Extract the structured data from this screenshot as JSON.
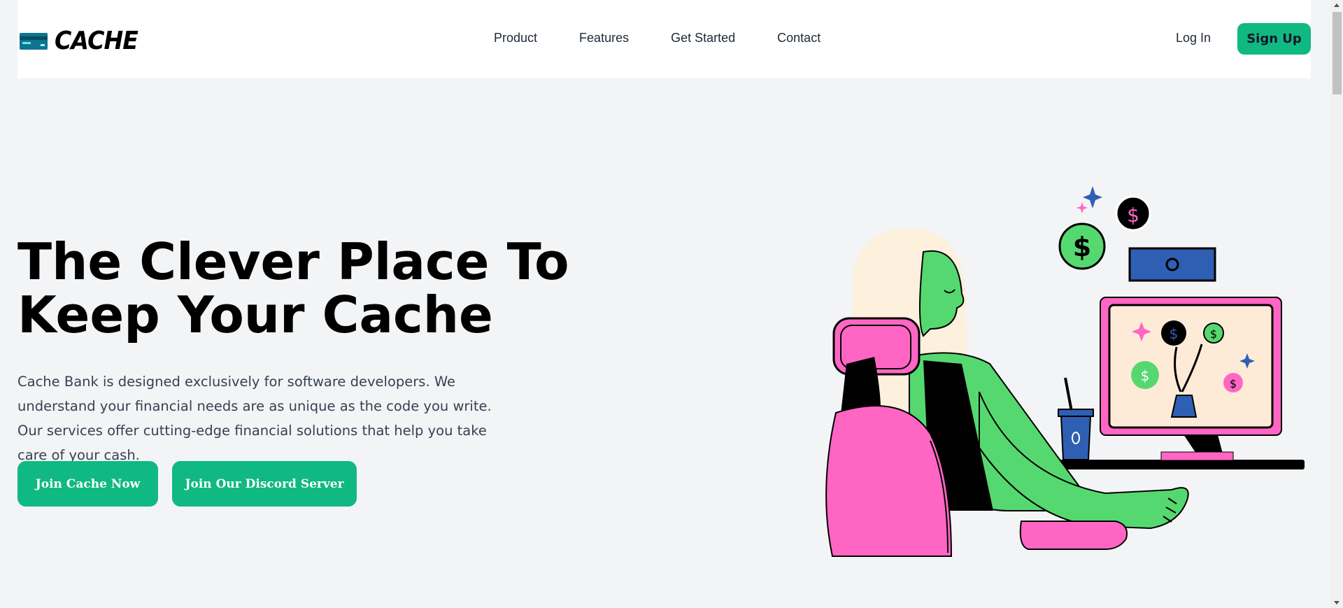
{
  "header": {
    "logo_text": "CACHE",
    "nav": [
      {
        "label": "Product"
      },
      {
        "label": "Features"
      },
      {
        "label": "Get Started"
      },
      {
        "label": "Contact"
      }
    ],
    "login_label": "Log In",
    "signup_label": "Sign Up"
  },
  "hero": {
    "title_line1": "The Clever Place To",
    "title_line2": "Keep Your Cache",
    "description": "Cache Bank is designed exclusively for software developers. We understand your financial needs are as unique as the code you write. Our services offer cutting-edge financial solutions that help you take care of your cash.",
    "cta_primary": "Join Cache Now",
    "cta_secondary": "Join Our Discord Server"
  },
  "colors": {
    "accent": "#10b981",
    "background": "#f3f4f6",
    "pink": "#ff66c4",
    "green": "#56d870",
    "blue": "#2f5fb3"
  },
  "icons": {
    "logo": "credit-card-icon",
    "illustration": "woman-at-computer-illustration"
  }
}
